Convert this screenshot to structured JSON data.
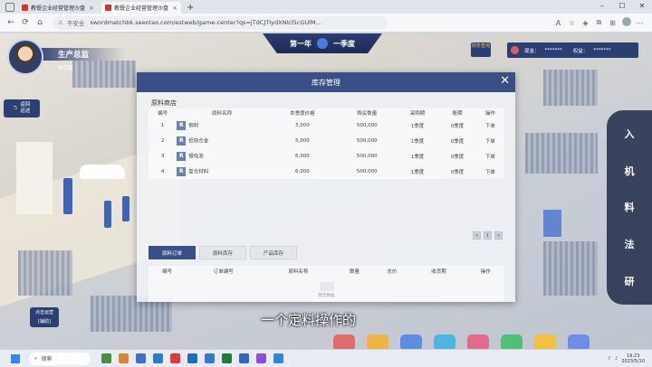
{
  "browser": {
    "tabs": [
      {
        "label": "教餐企业经营管理沙盘",
        "active": false
      },
      {
        "label": "教餐企业经营管理沙盘",
        "active": true
      }
    ],
    "address": {
      "insecure_label": "不安全",
      "url": "swordmatchbk.seentao.com/estweb/game-center?qs=jTdCJTIydXNlcl5cGUlM..."
    }
  },
  "hud": {
    "period": "第一年",
    "quarter": "一季度",
    "role_title": "生产总监",
    "role_name": "林莎毅",
    "finance_button": "财务查询",
    "cash_label": "现金：",
    "cash_value": "*******",
    "equity_label": "权益：",
    "equity_value": "*******",
    "back_button": "返回\n运送",
    "side_nav": [
      "入",
      "机",
      "料",
      "法",
      "研"
    ],
    "left_badge": "点击运营\n[辅助]",
    "subtitle": "一个定料操作的"
  },
  "modal": {
    "title": "库存管理",
    "section": "原料商店",
    "columns": [
      "编号",
      "原料名称",
      "本季度价格",
      "购买数量",
      "采购期",
      "账期",
      "操作"
    ],
    "rows": [
      {
        "id": "1",
        "name": "钢材",
        "price": "3,000",
        "qty": "500,000",
        "period": "1季度",
        "credit": "0季度",
        "action": "下单"
      },
      {
        "id": "2",
        "name": "铝锌合金",
        "price": "5,000",
        "qty": "500,000",
        "period": "1季度",
        "credit": "0季度",
        "action": "下单"
      },
      {
        "id": "3",
        "name": "锂电池",
        "price": "6,000",
        "qty": "500,000",
        "period": "1季度",
        "credit": "0季度",
        "action": "下单"
      },
      {
        "id": "4",
        "name": "复合材料",
        "price": "6,000",
        "qty": "500,000",
        "period": "1季度",
        "credit": "0季度",
        "action": "下单"
      }
    ],
    "pager": [
      "<",
      "1",
      ">"
    ],
    "tabs": [
      {
        "label": "原料订单",
        "active": true
      },
      {
        "label": "原料库存",
        "active": false
      },
      {
        "label": "产品库存",
        "active": false
      }
    ],
    "order_columns": [
      "编号",
      "订单编号",
      "原料名称",
      "数量",
      "总价",
      "收货期",
      "操作"
    ],
    "empty_text": "暂无数据"
  },
  "taskbar": {
    "search_placeholder": "搜索",
    "time": "19:23",
    "date": "2023/5/10"
  }
}
